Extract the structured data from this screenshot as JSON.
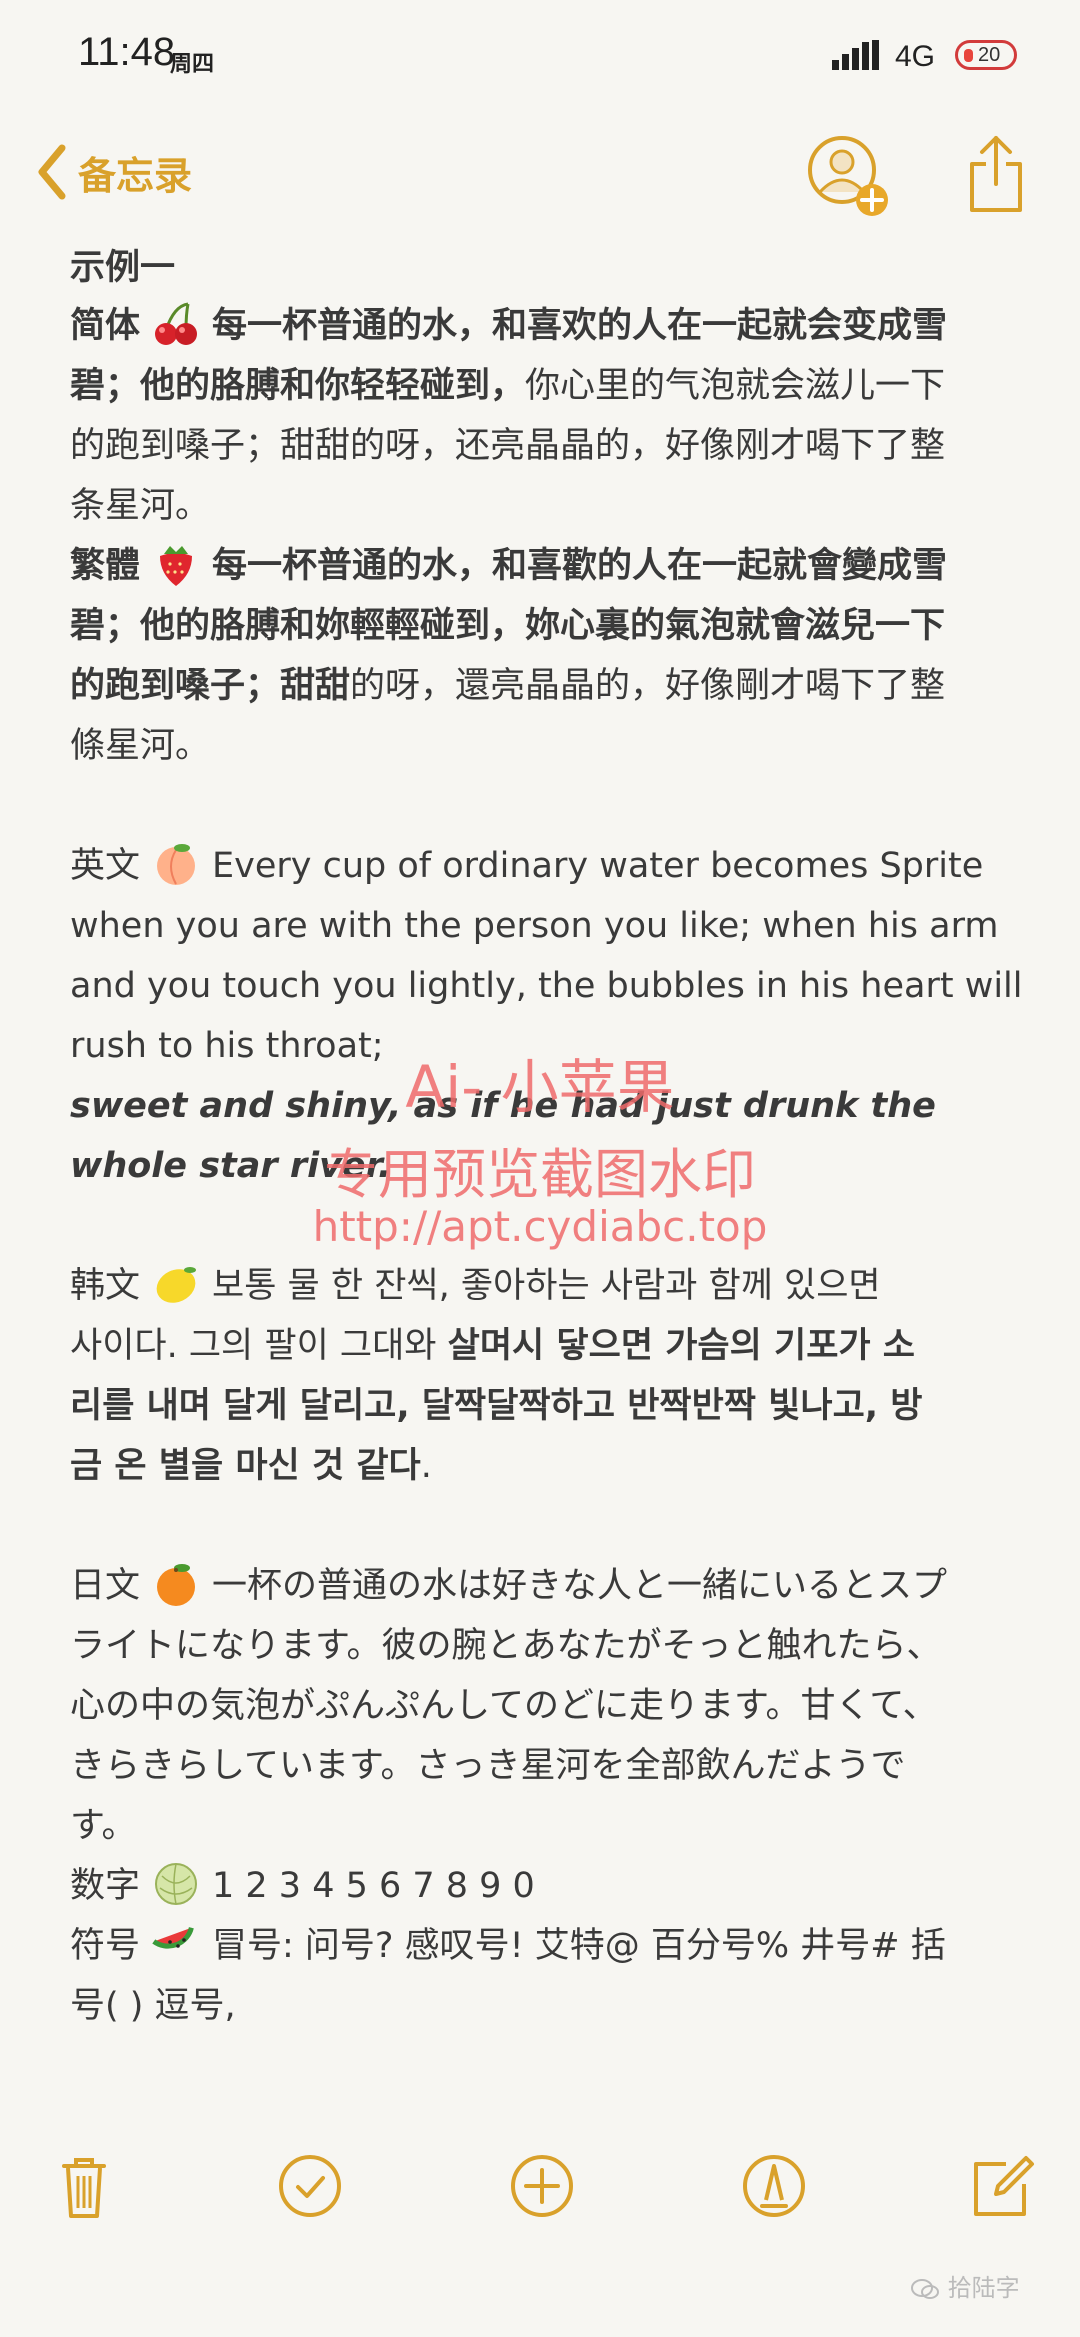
{
  "status": {
    "time": "11:48",
    "weekday": "周四",
    "network": "4G",
    "battery": "20"
  },
  "nav": {
    "back_label": "备忘录"
  },
  "note": {
    "title": "示例一",
    "simplified": {
      "label": "简体",
      "emoji": "cherries-emoji",
      "line1": "每一杯普通的水，和喜欢的人在一起就会变成雪",
      "line2_bold": "碧；他的胳膊和你轻轻碰到，",
      "line2_rest": "你心里的气泡就会滋儿一下",
      "line3": "的跑到嗓子；甜甜的呀，还亮晶晶的，好像刚才喝下了整",
      "line4": "条星河。"
    },
    "traditional": {
      "label": "繁體",
      "emoji": "strawberry-emoji",
      "line1": "每一杯普通的水，和喜歡的人在一起就會變成雪",
      "line2": "碧；他的胳膊和妳輕輕碰到，妳心裏的氣泡就會滋兒一下",
      "line3_bold": "的跑到嗓子；甜甜",
      "line3_rest": "的呀，還亮晶晶的，好像剛才喝下了整",
      "line4": "條星河。"
    },
    "english": {
      "label": "英文",
      "emoji": "peach-emoji",
      "line1": "Every cup of ordinary water becomes Sprite",
      "line2": "when you are with the person you like; when his arm",
      "line3": "and you touch you lightly, the bubbles in his heart will",
      "line4": "rush to his throat;",
      "line5": "sweet and shiny, as if he had just drunk the",
      "line6": "whole star river."
    },
    "korean": {
      "label": "韩文",
      "emoji": "lemon-emoji",
      "line1": "보통 물 한 잔씩, 좋아하는 사람과 함께 있으면",
      "line2_plain": "사이다. 그의 팔이 그대와 ",
      "line2_bold": "살며시 닿으면 가슴의 기포가 소",
      "line3": "리를 내며 달게 달리고, 달짝달짝하고 반짝반짝 빛나고, 방",
      "line4_bold": "금 온 별을 마신 것 같다",
      "line4_rest": "."
    },
    "japanese": {
      "label": "日文",
      "emoji": "tangerine-emoji",
      "line1": "一杯の普通の水は好きな人と一緒にいるとスプ",
      "line2": "ライトになります。彼の腕とあなたがそっと触れたら、",
      "line3": "心の中の気泡がぷんぷんしてのどに走ります。甘くて、",
      "line4": "きらきらしています。さっき星河を全部飲んだようで",
      "line5": "す。"
    },
    "numbers": {
      "label": "数字",
      "emoji": "melon-emoji",
      "text": "1 2 3 4 5 6 7 8 9 0"
    },
    "symbols": {
      "label": "符号",
      "emoji": "watermelon-emoji",
      "line1": "冒号: 问号? 感叹号! 艾特@ 百分号% 井号# 括",
      "line2": "号( ) 逗号,"
    }
  },
  "watermark": {
    "line1": "Ai- 小苹果",
    "line2": "专用预览截图水印",
    "line3": "http://apt.cydiabc.top"
  },
  "footer": {
    "account": "拾陆字"
  },
  "colors": {
    "accent": "#d9a12b",
    "watermark": "#ef6b6b",
    "background": "#f7f6f2"
  }
}
